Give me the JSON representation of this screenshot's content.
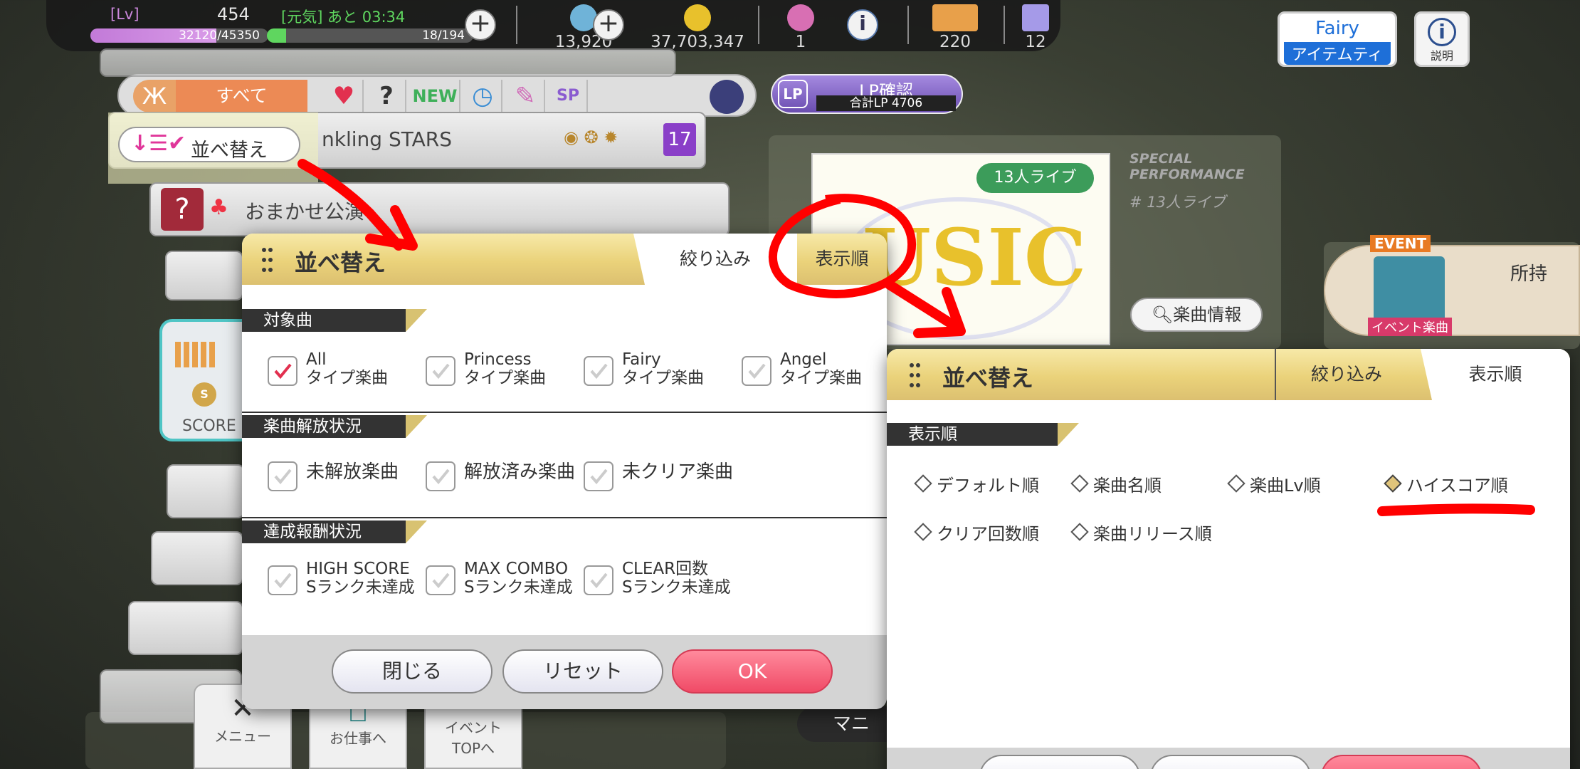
{
  "status": {
    "lv_label": "[Lv]",
    "lv_value": "454",
    "exp_text": "32120/45350",
    "exp_fraction": 0.708,
    "genki_label": "[元気] あと 03:34",
    "genki_text": "18/194",
    "genki_fraction": 0.093
  },
  "resources": {
    "gems": "13,920",
    "money": "37,703,347",
    "r3": "1",
    "r4": "220",
    "r5": "12"
  },
  "filter": {
    "all_label": "すべて",
    "new_label": "NEW",
    "lp_title": "LP確認",
    "lp_total": "合計LP 4706"
  },
  "top_right": {
    "fairy_top": "Fairy",
    "fairy_bottom": "アイテムティ",
    "info_label": "説明"
  },
  "list": {
    "sort_button": "並べ替え",
    "row1_title": "nkling STARS",
    "row1_count": "17",
    "row2_title": "おまかせ公演"
  },
  "right_panel": {
    "special": "SPECIAL",
    "performance": "PERFORMANCE",
    "live13": "# 13人ライブ",
    "badge": "13人ライブ",
    "music_info": "楽曲情報",
    "event_badge": "EVENT",
    "event_song": "イベント楽曲",
    "shoji": "所持"
  },
  "bottom_nav": {
    "menu": "メニュー",
    "work": "お仕事へ",
    "event1": "イベント",
    "event2": "TOPへ",
    "score": "SCORE",
    "mani": "マニ"
  },
  "dialog1": {
    "title": "並べ替え",
    "tab_filter": "絞り込み",
    "tab_order": "表示順",
    "sec1": "対象曲",
    "sec2": "楽曲解放状況",
    "sec3": "達成報酬状況",
    "type_items": [
      {
        "l1": "All",
        "l2": "タイプ楽曲",
        "checked": true
      },
      {
        "l1": "Princess",
        "l2": "タイプ楽曲",
        "checked": false
      },
      {
        "l1": "Fairy",
        "l2": "タイプ楽曲",
        "checked": false
      },
      {
        "l1": "Angel",
        "l2": "タイプ楽曲",
        "checked": false
      }
    ],
    "release_items": [
      "未解放楽曲",
      "解放済み楽曲",
      "未クリア楽曲"
    ],
    "reward_items": [
      {
        "l1": "HIGH SCORE",
        "l2": "Sランク未達成"
      },
      {
        "l1": "MAX COMBO",
        "l2": "Sランク未達成"
      },
      {
        "l1": "CLEAR回数",
        "l2": "Sランク未達成"
      }
    ],
    "close": "閉じる",
    "reset": "リセット",
    "ok": "OK"
  },
  "dialog2": {
    "title": "並べ替え",
    "tab_filter": "絞り込み",
    "tab_order": "表示順",
    "sec": "表示順",
    "options": [
      "デフォルト順",
      "楽曲名順",
      "楽曲Lv順",
      "ハイスコア順",
      "クリア回数順",
      "楽曲リリース順"
    ],
    "selected": "ハイスコア順"
  }
}
